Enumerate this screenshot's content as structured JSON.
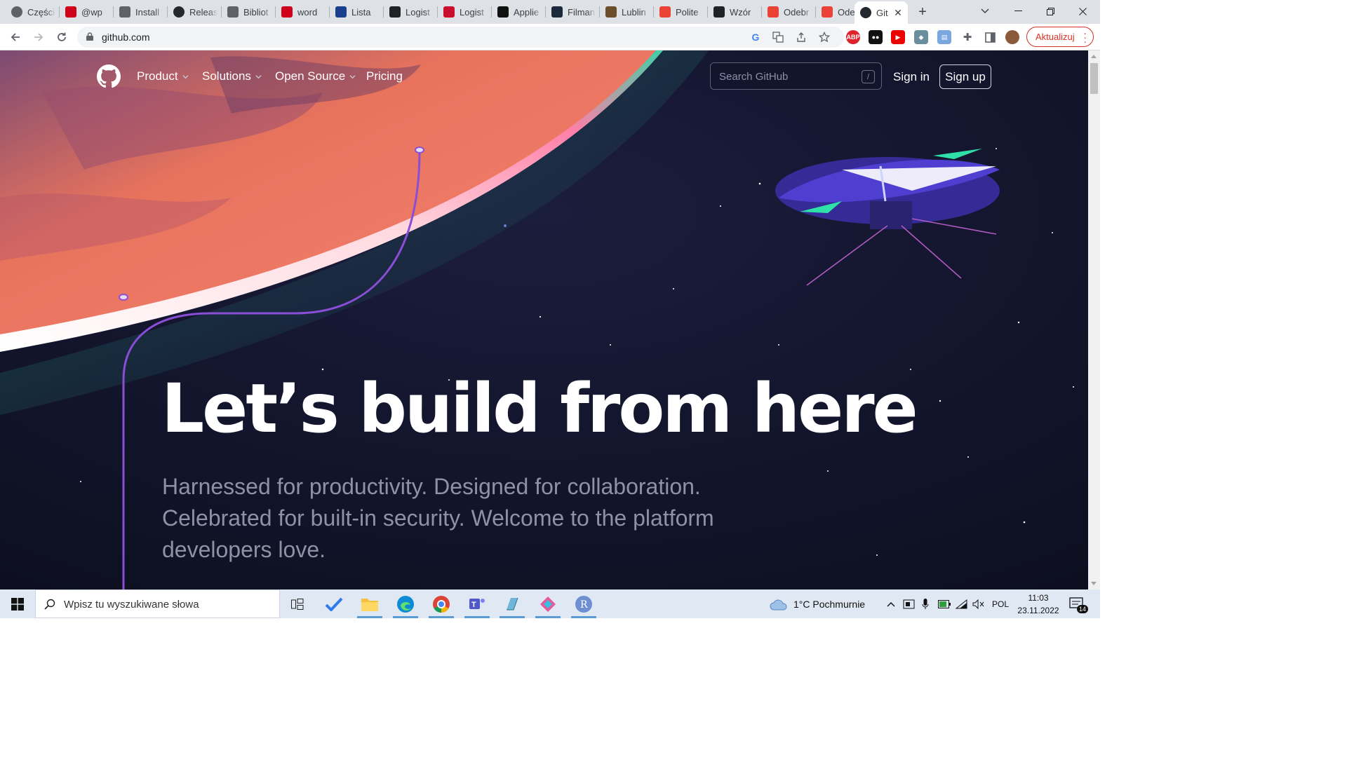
{
  "browser": {
    "tabs": [
      {
        "title": "Części",
        "icon": "chrome-icon",
        "color": "#5f6368"
      },
      {
        "title": "@wp",
        "icon": "wp-icon",
        "color": "#d0021b"
      },
      {
        "title": "Install",
        "icon": "shield-icon",
        "color": "#5f6368"
      },
      {
        "title": "Releas",
        "icon": "github-icon",
        "color": "#24292f"
      },
      {
        "title": "Bibliot",
        "icon": "globe-icon",
        "color": "#5f6368"
      },
      {
        "title": "word",
        "icon": "z-icon",
        "color": "#d0021b"
      },
      {
        "title": "Lista",
        "icon": "e-icon",
        "color": "#1a3f8e"
      },
      {
        "title": "Logist",
        "icon": "wikipedia-icon",
        "color": "#202124"
      },
      {
        "title": "Logist",
        "icon": "jn-icon",
        "color": "#c8102e"
      },
      {
        "title": "Applie",
        "icon": "w-icon",
        "color": "#111111"
      },
      {
        "title": "Filman",
        "icon": "filman-icon",
        "color": "#1b2a3a"
      },
      {
        "title": "Lublin",
        "icon": "lublin-icon",
        "color": "#6b4f2a"
      },
      {
        "title": "Polite",
        "icon": "maps-pin-icon",
        "color": "#ea4335"
      },
      {
        "title": "Wzór",
        "icon": "wikipedia-icon",
        "color": "#202124"
      },
      {
        "title": "Odebr",
        "icon": "gmail-icon",
        "color": "#ea4335"
      },
      {
        "title": "Odebr",
        "icon": "gmail-icon",
        "color": "#ea4335"
      },
      {
        "title": "Git",
        "icon": "github-icon",
        "color": "#24292f",
        "active": true
      }
    ],
    "url": "github.com",
    "update_label": "Aktualizuj"
  },
  "github": {
    "nav": [
      {
        "label": "Product",
        "dropdown": true
      },
      {
        "label": "Solutions",
        "dropdown": true
      },
      {
        "label": "Open Source",
        "dropdown": true
      },
      {
        "label": "Pricing",
        "dropdown": false
      }
    ],
    "search_placeholder": "Search GitHub",
    "search_shortcut": "/",
    "sign_in": "Sign in",
    "sign_up": "Sign up",
    "hero_title": "Let’s build from here",
    "hero_subtitle": "Harnessed for productivity. Designed for collaboration. Celebrated for built-in security. Welcome to the platform developers love.",
    "colors": {
      "background": "#0d1024",
      "planet": "#e8735d",
      "trail": "#8a4dd6"
    }
  },
  "taskbar": {
    "search_text": "Wpisz tu wyszukiwane słowa",
    "weather": "1°C  Pochmurnie",
    "language": "POL",
    "time": "11:03",
    "date": "23.11.2022",
    "notifications": "14"
  }
}
